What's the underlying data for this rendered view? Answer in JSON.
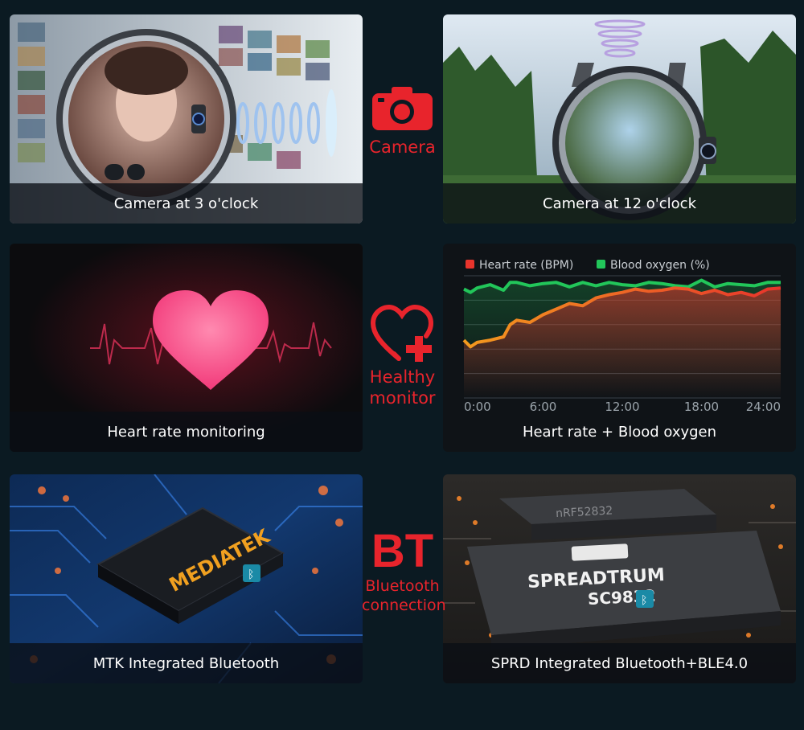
{
  "center": {
    "camera_label": "Camera",
    "health_label_line1": "Healthy",
    "health_label_line2": "monitor",
    "bt_big": "BT",
    "bt_line1": "Bluetooth",
    "bt_line2": "connection"
  },
  "panels": {
    "camera_3": {
      "caption": "Camera at 3 o'clock"
    },
    "camera_12": {
      "caption": "Camera at 12 o'clock"
    },
    "heart": {
      "caption": "Heart rate monitoring"
    },
    "chart": {
      "caption": "Heart rate + Blood oxygen"
    },
    "mtk": {
      "caption": "MTK Integrated Bluetooth",
      "chip_text": "MEDIATEK"
    },
    "sprd": {
      "caption": "SPRD Integrated Bluetooth+BLE4.0",
      "chip_brand": "SPREADTRUM",
      "chip_model": "SC9832",
      "chip_small": "nRF52832"
    }
  },
  "colors": {
    "accent": "#e8242c",
    "heart_rate": "#e8342c",
    "blood_oxygen": "#22c65a",
    "heart_pink": "#ff4f8a"
  },
  "chart_data": {
    "type": "area",
    "legend": [
      "Heart rate (BPM)",
      "Blood oxygen (%)"
    ],
    "x_ticks": [
      "0:00",
      "6:00",
      "12:00",
      "18:00",
      "24:00"
    ],
    "xlim": [
      0,
      24
    ],
    "ylim": [
      0,
      100
    ],
    "grid": true,
    "legend_placement": "top-left",
    "series": [
      {
        "name": "Heart rate (BPM)",
        "x": [
          0,
          0.5,
          1,
          2,
          3,
          3.5,
          4,
          5,
          6,
          7,
          8,
          9,
          10,
          11,
          12,
          13,
          14,
          15,
          16,
          17,
          18,
          19,
          20,
          21,
          22,
          23,
          24
        ],
        "values": [
          52,
          46,
          50,
          52,
          55,
          66,
          70,
          68,
          75,
          80,
          85,
          83,
          90,
          93,
          95,
          98,
          96,
          97,
          99,
          98,
          94,
          97,
          93,
          95,
          92,
          98,
          99
        ]
      },
      {
        "name": "Blood oxygen (%)",
        "x": [
          0,
          0.5,
          1,
          2,
          3,
          3.5,
          4,
          5,
          6,
          7,
          8,
          9,
          10,
          11,
          12,
          13,
          14,
          15,
          16,
          17,
          18,
          19,
          20,
          21,
          22,
          23,
          24
        ],
        "values": [
          98,
          95,
          99,
          102,
          97,
          104,
          104,
          101,
          103,
          104,
          100,
          104,
          101,
          104,
          102,
          101,
          104,
          103,
          101,
          100,
          106,
          100,
          103,
          102,
          101,
          104,
          104
        ]
      }
    ]
  }
}
